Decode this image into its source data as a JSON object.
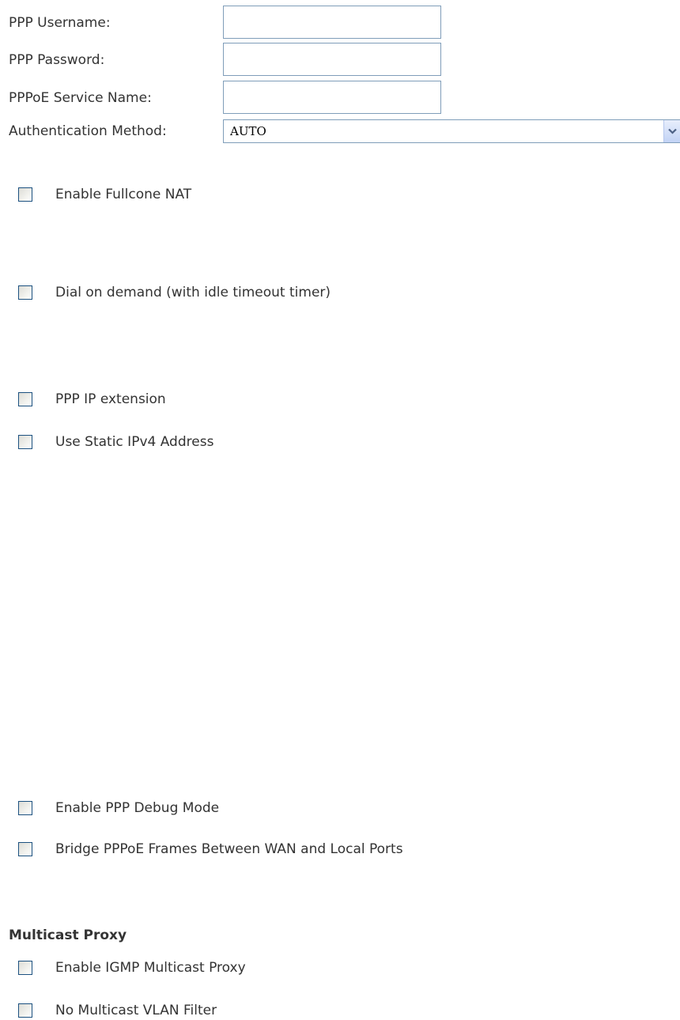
{
  "fields": {
    "username_label": "PPP Username:",
    "username_value": "",
    "password_label": "PPP Password:",
    "password_value": "",
    "service_name_label": "PPPoE Service Name:",
    "service_name_value": "",
    "auth_method_label": "Authentication Method:",
    "auth_method_value": "AUTO"
  },
  "options": {
    "fullcone_nat": "Enable Fullcone NAT",
    "dial_on_demand": "Dial on demand (with idle timeout timer)",
    "ppp_ip_extension": "PPP IP extension",
    "static_ipv4": "Use Static IPv4 Address",
    "ppp_debug": "Enable PPP Debug Mode",
    "bridge_pppoe": "Bridge PPPoE Frames Between WAN and Local Ports"
  },
  "multicast": {
    "heading": "Multicast Proxy",
    "igmp_proxy": "Enable IGMP Multicast Proxy",
    "no_vlan_filter": "No Multicast VLAN Filter"
  },
  "checked": {
    "fullcone_nat": false,
    "dial_on_demand": false,
    "ppp_ip_extension": false,
    "static_ipv4": false,
    "ppp_debug": false,
    "bridge_pppoe": false,
    "igmp_proxy": false,
    "no_vlan_filter": false
  },
  "icons": {
    "select_arrow": "chevron-down-icon"
  },
  "colors": {
    "text": "#333333",
    "input_border": "#7f9db9",
    "checkbox_border": "#1c5180"
  }
}
